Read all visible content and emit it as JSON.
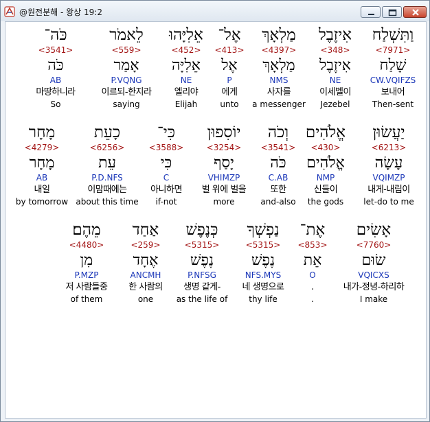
{
  "window": {
    "title": "@원전분해 - 왕상 19:2"
  },
  "rows": [
    {
      "words": [
        {
          "hebrew": "וַתִּשְׁלַח",
          "strong": "<7971>",
          "lemma": "שָׁלַח",
          "parse": "CW.VQIFZS",
          "korean": "보내어",
          "english": "Then-sent"
        },
        {
          "hebrew": "אִיזֶבֶל",
          "strong": "<348>",
          "lemma": "אִיזֶבֶל",
          "parse": "NE",
          "korean": "이세벨이",
          "english": "Jezebel"
        },
        {
          "hebrew": "מַלְאָךְ",
          "strong": "<4397>",
          "lemma": "מַלְאָךְ",
          "parse": "NMS",
          "korean": "사자를",
          "english": "a messenger"
        },
        {
          "hebrew": "אֶל־",
          "strong": "<413>",
          "lemma": "אֶל",
          "parse": "P",
          "korean": "에게",
          "english": "unto"
        },
        {
          "hebrew": "אֵלִיָּהוּ",
          "strong": "<452>",
          "lemma": "אֵלִיָּה",
          "parse": "NE",
          "korean": "엘리야",
          "english": "Elijah"
        },
        {
          "hebrew": "לֵאמֹר",
          "strong": "<559>",
          "lemma": "אָמַר",
          "parse": "P.VQNG",
          "korean": "이르되-한지라",
          "english": "saying"
        },
        {
          "hebrew": "כֹּה־",
          "strong": "<3541>",
          "lemma": "כֹּה",
          "parse": "AB",
          "korean": "마땅하니라",
          "english": "So"
        }
      ]
    },
    {
      "words": [
        {
          "hebrew": "יַעֲשׂוּן",
          "strong": "<6213>",
          "lemma": "עָשָׂה",
          "parse": "VQIMZP",
          "korean": "내게-내림이",
          "english": "let-do to me"
        },
        {
          "hebrew": "אֱלֹהִים",
          "strong": "<430>",
          "lemma": "אֱלֹהִים",
          "parse": "NMP",
          "korean": "신들이",
          "english": "the gods"
        },
        {
          "hebrew": "וְכֹה",
          "strong": "<3541>",
          "lemma": "כֹּה",
          "parse": "C.AB",
          "korean": "또한",
          "english": "and-also"
        },
        {
          "hebrew": "יוֹסִפוּן",
          "strong": "<3254>",
          "lemma": "יָסַף",
          "parse": "VHIMZP",
          "korean": "벌 위에 벌을",
          "english": "more"
        },
        {
          "hebrew": "כִּי־",
          "strong": "<3588>",
          "lemma": "כִּי",
          "parse": "C",
          "korean": "아니하면",
          "english": "if-not"
        },
        {
          "hebrew": "כָעֵת",
          "strong": "<6256>",
          "lemma": "עֵת",
          "parse": "P.D.NFS",
          "korean": "이맘때에는",
          "english": "about this time"
        },
        {
          "hebrew": "מָחָר",
          "strong": "<4279>",
          "lemma": "מָחָר",
          "parse": "AB",
          "korean": "내일",
          "english": "by tomorrow"
        }
      ]
    },
    {
      "words": [
        {
          "hebrew": "אָשִׂים",
          "strong": "<7760>",
          "lemma": "שׂוּם",
          "parse": "VQICXS",
          "korean": "내가-정녕-하리하",
          "english": "I make"
        },
        {
          "hebrew": "אֶת־",
          "strong": "<853>",
          "lemma": "אֵת",
          "parse": "O",
          "korean": ".",
          "english": "."
        },
        {
          "hebrew": "נַפְשְׁךָ",
          "strong": "<5315>",
          "lemma": "נֶפֶשׁ",
          "parse": "NFS.MYS",
          "korean": "네 생명으로",
          "english": "thy life"
        },
        {
          "hebrew": "כְּנֶפֶשׁ",
          "strong": "<5315>",
          "lemma": "נֶפֶשׁ",
          "parse": "P.NFSG",
          "korean": "생명 같게-",
          "english": "as the life of"
        },
        {
          "hebrew": "אַחַד",
          "strong": "<259>",
          "lemma": "אֶחָד",
          "parse": "ANCMH",
          "korean": "한 사람의",
          "english": "one"
        },
        {
          "hebrew": "מֵהֶם׃",
          "strong": "<4480>",
          "lemma": "מִן",
          "parse": "P.MZP",
          "korean": "저 사람들중",
          "english": "of them"
        }
      ]
    }
  ]
}
